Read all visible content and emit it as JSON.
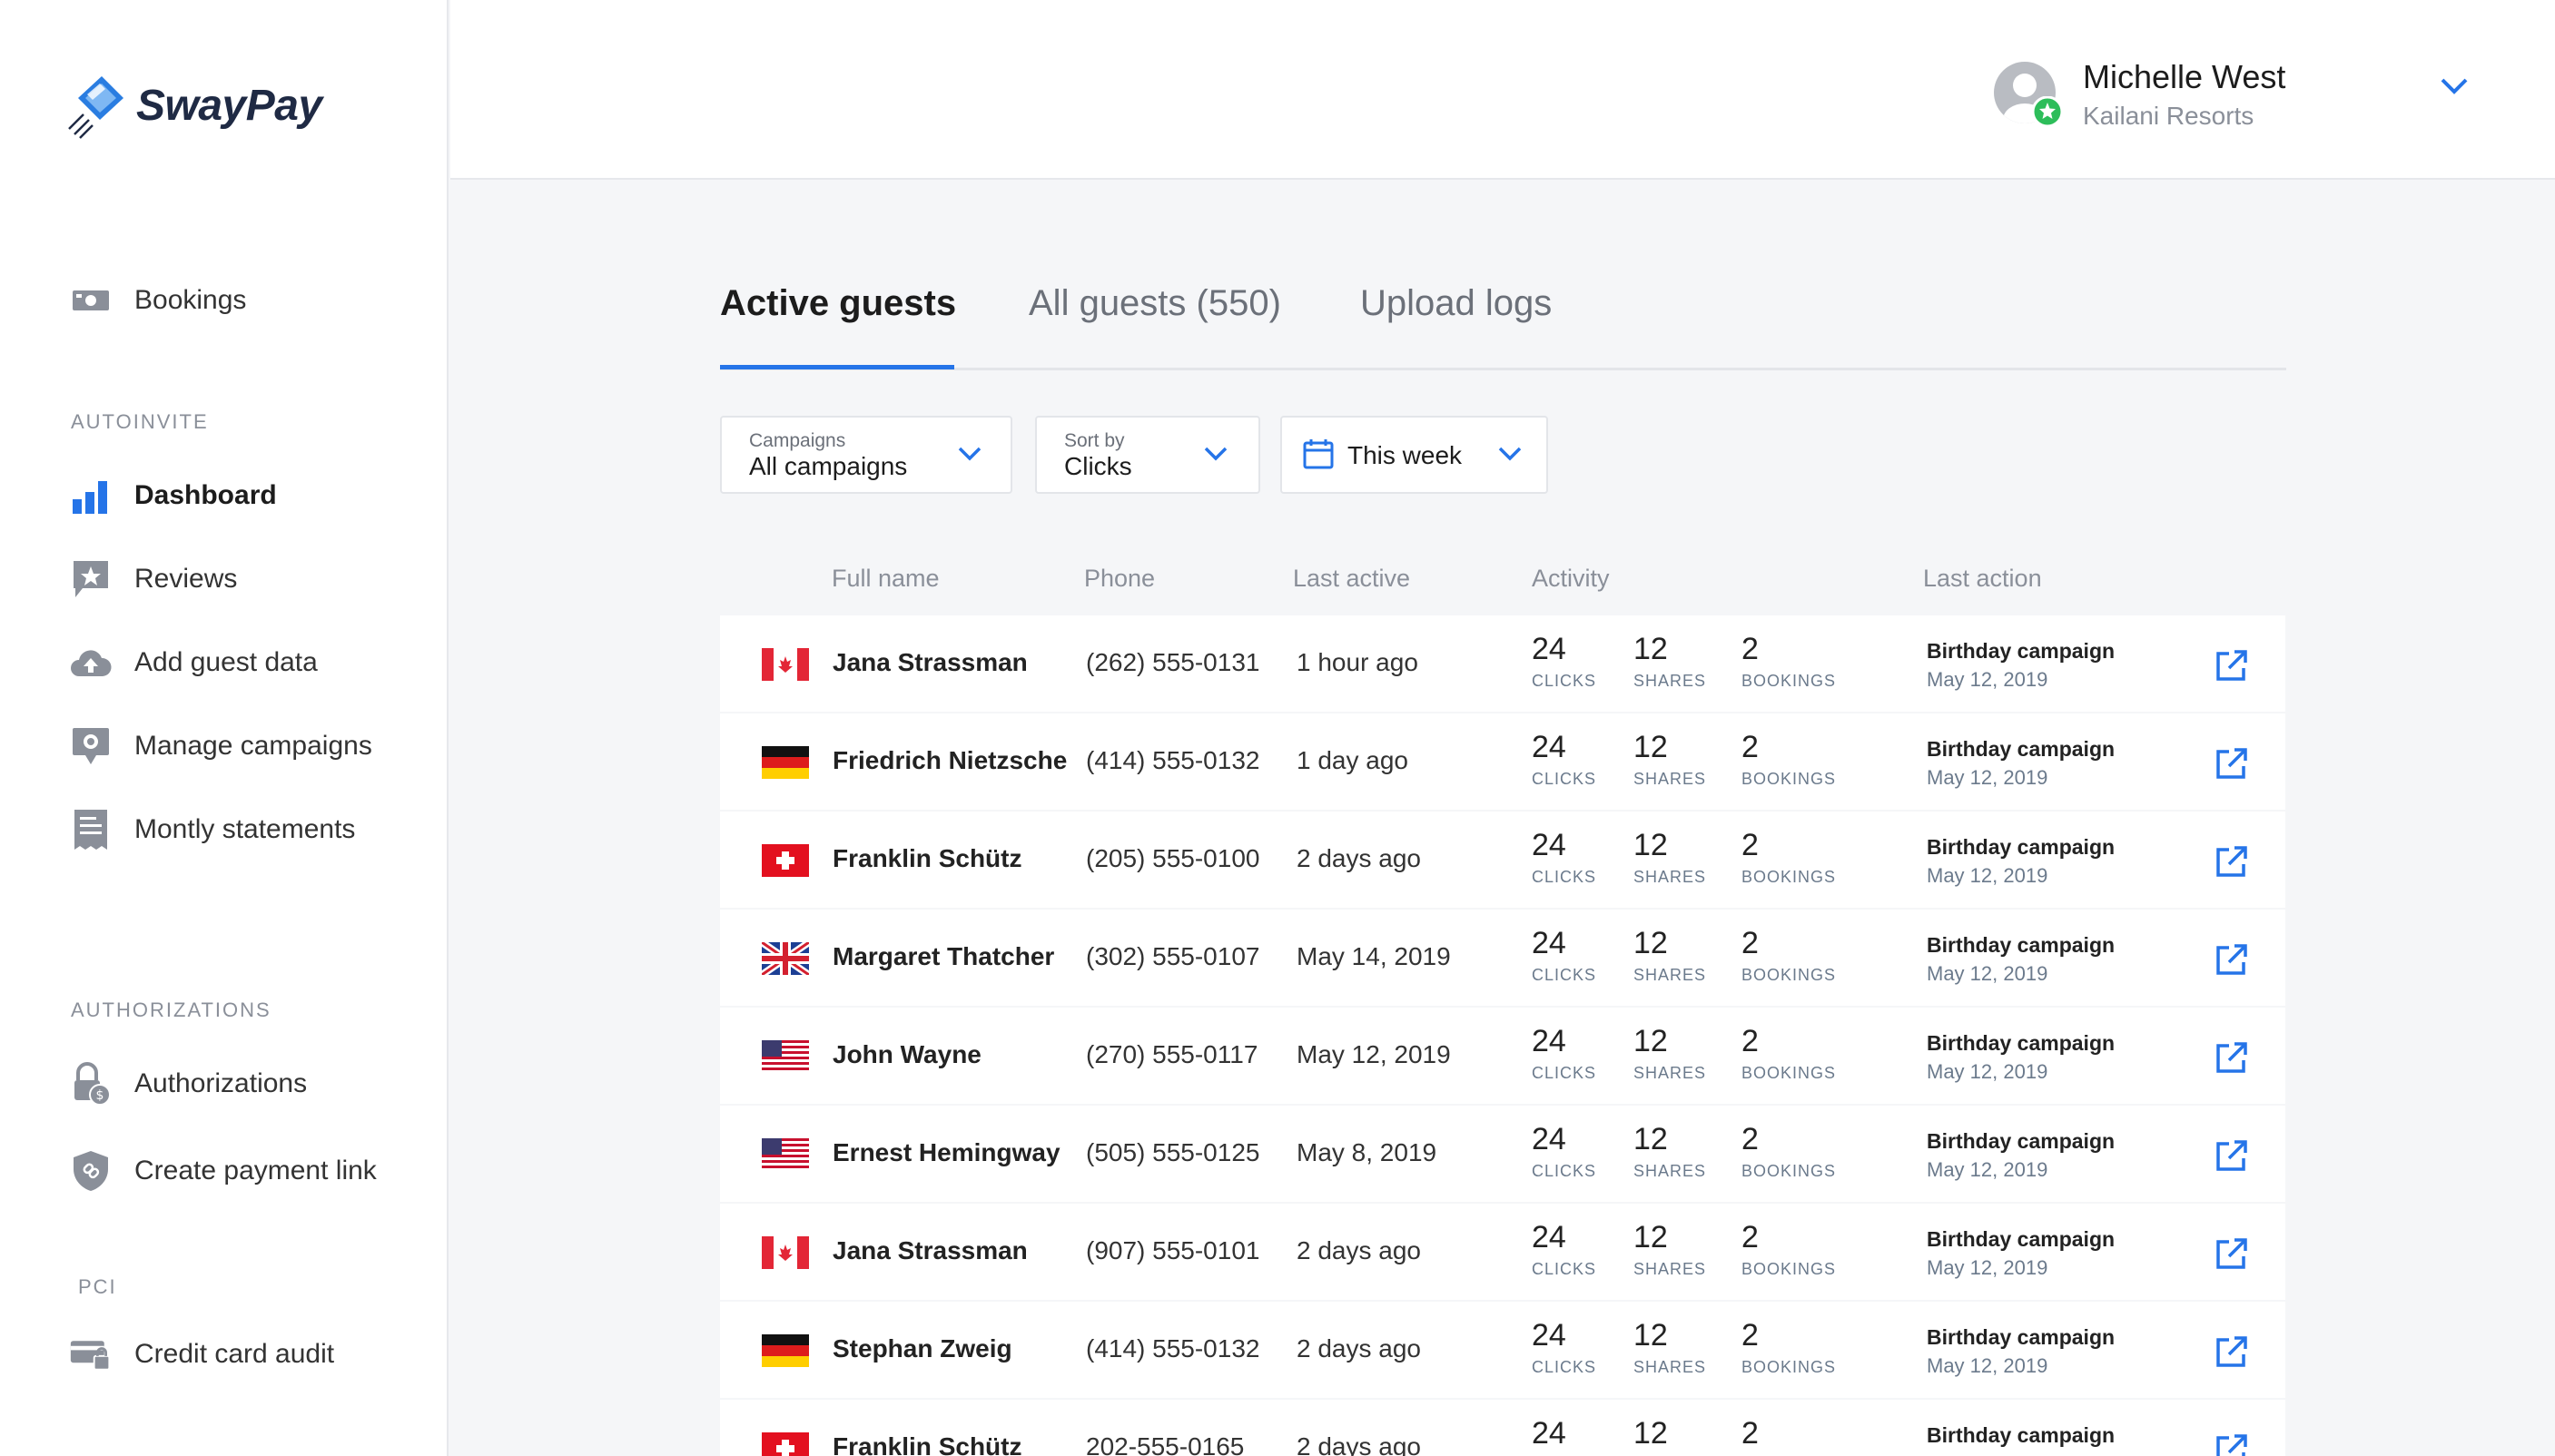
{
  "brand": {
    "name": "SwayPay",
    "accent": "#2574e8"
  },
  "sidebar": {
    "items_top": [
      {
        "label": "Bookings",
        "icon": "money-icon"
      }
    ],
    "sections": [
      {
        "title": "AUTOINVITE",
        "items": [
          {
            "label": "Dashboard",
            "icon": "bar-chart-icon",
            "active": true
          },
          {
            "label": "Reviews",
            "icon": "review-star-icon"
          },
          {
            "label": "Add guest data",
            "icon": "cloud-upload-icon"
          },
          {
            "label": "Manage campaigns",
            "icon": "campaign-settings-icon"
          },
          {
            "label": "Montly statements",
            "icon": "receipt-icon"
          }
        ]
      },
      {
        "title": "AUTHORIZATIONS",
        "items": [
          {
            "label": "Authorizations",
            "icon": "lock-dollar-icon"
          },
          {
            "label": "Create payment link",
            "icon": "shield-link-icon"
          }
        ]
      },
      {
        "title": "PCI",
        "items": [
          {
            "label": "Credit card audit",
            "icon": "card-lock-icon"
          }
        ]
      }
    ]
  },
  "header": {
    "user_name": "Michelle West",
    "user_org": "Kailani Resorts"
  },
  "tabs": [
    {
      "label": "Active guests",
      "active": true
    },
    {
      "label": "All guests (550)"
    },
    {
      "label": "Upload logs"
    }
  ],
  "filters": {
    "campaigns": {
      "label": "Campaigns",
      "value": "All campaigns"
    },
    "sort": {
      "label": "Sort by",
      "value": "Clicks"
    },
    "date": {
      "value": "This week"
    }
  },
  "table": {
    "headers": {
      "name": "Full name",
      "phone": "Phone",
      "last_active": "Last active",
      "activity": "Activity",
      "last_action": "Last action"
    },
    "captions": {
      "clicks": "CLICKS",
      "shares": "SHARES",
      "bookings": "BOOKINGS"
    },
    "rows": [
      {
        "flag": "ca",
        "name": "Jana Strassman",
        "phone": "(262) 555-0131",
        "last_active": "1 hour ago",
        "clicks": "24",
        "shares": "12",
        "bookings": "2",
        "action": "Birthday campaign",
        "date": "May 12, 2019"
      },
      {
        "flag": "de",
        "name": "Friedrich Nietzsche",
        "phone": "(414) 555-0132",
        "last_active": "1 day ago",
        "clicks": "24",
        "shares": "12",
        "bookings": "2",
        "action": "Birthday campaign",
        "date": "May 12, 2019"
      },
      {
        "flag": "ch",
        "name": "Franklin Schütz",
        "phone": "(205) 555-0100",
        "last_active": "2 days ago",
        "clicks": "24",
        "shares": "12",
        "bookings": "2",
        "action": "Birthday campaign",
        "date": "May 12, 2019"
      },
      {
        "flag": "gb",
        "name": "Margaret Thatcher",
        "phone": "(302) 555-0107",
        "last_active": "May 14, 2019",
        "clicks": "24",
        "shares": "12",
        "bookings": "2",
        "action": "Birthday campaign",
        "date": "May 12, 2019"
      },
      {
        "flag": "us",
        "name": "John Wayne",
        "phone": "(270) 555-0117",
        "last_active": "May 12, 2019",
        "clicks": "24",
        "shares": "12",
        "bookings": "2",
        "action": "Birthday campaign",
        "date": "May 12, 2019"
      },
      {
        "flag": "us",
        "name": "Ernest Hemingway",
        "phone": "(505) 555-0125",
        "last_active": "May 8, 2019",
        "clicks": "24",
        "shares": "12",
        "bookings": "2",
        "action": "Birthday campaign",
        "date": "May 12, 2019"
      },
      {
        "flag": "ca",
        "name": "Jana Strassman",
        "phone": "(907) 555-0101",
        "last_active": "2 days ago",
        "clicks": "24",
        "shares": "12",
        "bookings": "2",
        "action": "Birthday campaign",
        "date": "May 12, 2019"
      },
      {
        "flag": "de",
        "name": "Stephan Zweig",
        "phone": "(414) 555-0132",
        "last_active": "2 days ago",
        "clicks": "24",
        "shares": "12",
        "bookings": "2",
        "action": "Birthday campaign",
        "date": "May 12, 2019"
      },
      {
        "flag": "ch",
        "name": "Franklin Schütz",
        "phone": "202-555-0165",
        "last_active": "2 days ago",
        "clicks": "24",
        "shares": "12",
        "bookings": "2",
        "action": "Birthday campaign",
        "date": ""
      }
    ]
  }
}
